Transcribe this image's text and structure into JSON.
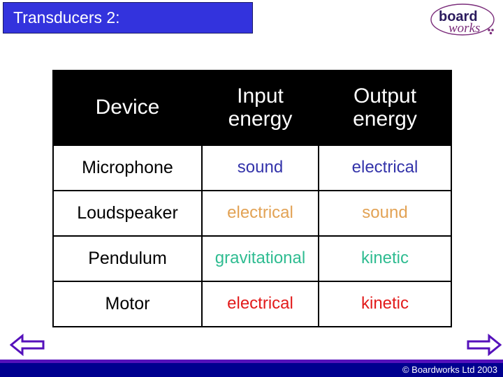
{
  "slide": {
    "title": "Transducers 2:"
  },
  "logo": {
    "name": "boardworks-logo",
    "word_top": "board",
    "word_bottom": "works",
    "color_primary": "#2b1b5e",
    "color_secondary": "#7b2d7b"
  },
  "table": {
    "headers": [
      {
        "lines": [
          "Device"
        ]
      },
      {
        "lines": [
          "Input",
          "energy"
        ]
      },
      {
        "lines": [
          "Output",
          "energy"
        ]
      }
    ],
    "header_bg": "#000000",
    "header_fg": "#ffffff",
    "rows": [
      {
        "device": "Microphone",
        "input": "sound",
        "output": "electrical",
        "color": "#3333aa"
      },
      {
        "device": "Loudspeaker",
        "input": "electrical",
        "output": "sound",
        "color": "#e2a254"
      },
      {
        "device": "Pendulum",
        "input": "gravitational",
        "output": "kinetic",
        "color": "#2fbc91"
      },
      {
        "device": "Motor",
        "input": "electrical",
        "output": "kinetic",
        "color": "#e21b1b"
      }
    ]
  },
  "navigation": {
    "prev_label": "previous-slide-arrow",
    "next_label": "next-slide-arrow",
    "arrow_color": "#5511bb"
  },
  "footer": {
    "copyright": "© Boardworks Ltd 2003",
    "rule_color": "#5511bb",
    "bar_color": "#00008f"
  },
  "theme": {
    "title_bg": "#3333dd",
    "title_fg": "#ffffff"
  }
}
